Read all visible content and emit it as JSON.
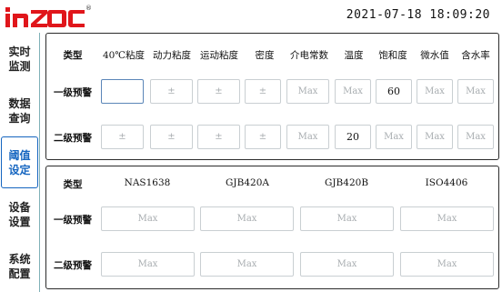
{
  "header": {
    "logo_text": "inZOC",
    "logo_mark": "®",
    "datetime": "2021-07-18 18:09:20"
  },
  "sidebar": {
    "items": [
      {
        "label": "实时\n监测",
        "active": false
      },
      {
        "label": "数据\n查询",
        "active": false
      },
      {
        "label": "阈值\n设定",
        "active": true
      },
      {
        "label": "设备\n设置",
        "active": false
      },
      {
        "label": "系统\n配置",
        "active": false
      }
    ]
  },
  "panel1": {
    "type_label": "类型",
    "columns": [
      "40℃粘度",
      "动力粘度",
      "运动粘度",
      "密度",
      "介电常数",
      "温度",
      "饱和度",
      "微水值",
      "含水率"
    ],
    "rows": [
      {
        "label": "一级预警",
        "cells": [
          "",
          "±",
          "±",
          "±",
          "Max",
          "Max",
          "60",
          "Max",
          "Max"
        ]
      },
      {
        "label": "二级预警",
        "cells": [
          "±",
          "±",
          "±",
          "±",
          "Max",
          "20",
          "Max",
          "Max",
          "Max"
        ]
      }
    ]
  },
  "panel2": {
    "type_label": "类型",
    "columns": [
      "NAS1638",
      "GJB420A",
      "GJB420B",
      "ISO4406"
    ],
    "rows": [
      {
        "label": "一级预警",
        "cells": [
          "Max",
          "Max",
          "Max",
          "Max"
        ]
      },
      {
        "label": "二级预警",
        "cells": [
          "Max",
          "Max",
          "Max",
          "Max"
        ]
      }
    ]
  },
  "colors": {
    "brand_red": "#e0161b",
    "active_nav": "#1565c0",
    "sidebar_border": "#7fb1b7",
    "cell_border": "#c9cfd2",
    "placeholder_text": "#a8adb0"
  }
}
